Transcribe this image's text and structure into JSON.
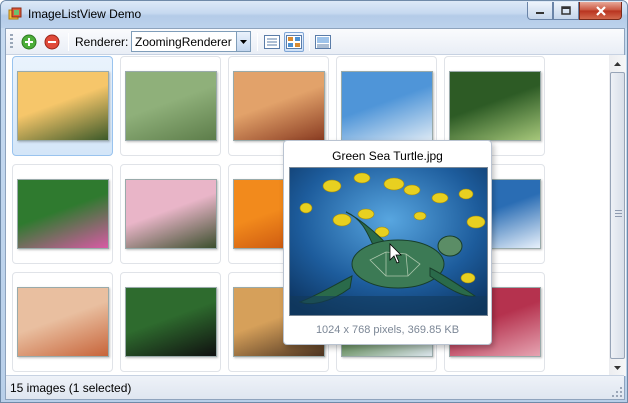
{
  "window": {
    "title": "ImageListView Demo",
    "icon": "app-icon"
  },
  "toolbar": {
    "add_icon": "add-icon",
    "remove_icon": "remove-icon",
    "renderer_label": "Renderer:",
    "renderer_value": "ZoomingRenderer",
    "view_buttons": [
      "details-view-icon",
      "thumbnails-view-icon",
      "gallery-view-icon"
    ],
    "active_view": "thumbnails-view-icon"
  },
  "thumbnails": [
    {
      "name": "sunset-tree",
      "selected": true,
      "colors": [
        "#f6c66a",
        "#3d5a2a"
      ]
    },
    {
      "name": "river-meadow",
      "selected": false,
      "colors": [
        "#8fb07a",
        "#5d7d4a"
      ]
    },
    {
      "name": "desert-monument",
      "selected": false,
      "colors": [
        "#e2a26a",
        "#8a3c22"
      ]
    },
    {
      "name": "green-sea-turtle",
      "selected": false,
      "colors": [
        "#4f95d8",
        "#dbe8f4"
      ]
    },
    {
      "name": "forest-path",
      "selected": false,
      "colors": [
        "#2d5b25",
        "#a6c77a"
      ]
    },
    {
      "name": "pink-flowers-green",
      "selected": false,
      "colors": [
        "#2f7a2f",
        "#d95aa5"
      ]
    },
    {
      "name": "pink-blossoms",
      "selected": false,
      "colors": [
        "#e9b5c8",
        "#3b4f2d"
      ]
    },
    {
      "name": "orange-flowers",
      "selected": false,
      "colors": [
        "#f28a1c",
        "#c24b0d"
      ]
    },
    {
      "name": "hidden-blue",
      "selected": false,
      "colors": [
        "#6da9dc",
        "#bcd7ef"
      ]
    },
    {
      "name": "whale-splash",
      "selected": false,
      "colors": [
        "#2a6db4",
        "#e8f1fb"
      ]
    },
    {
      "name": "desert-oryx",
      "selected": false,
      "colors": [
        "#e9bfa0",
        "#c7643a"
      ]
    },
    {
      "name": "toucan",
      "selected": false,
      "colors": [
        "#2e6b2e",
        "#101010"
      ]
    },
    {
      "name": "autumn-trees",
      "selected": false,
      "colors": [
        "#d6a05a",
        "#4c3320"
      ]
    },
    {
      "name": "waterfall",
      "selected": false,
      "colors": [
        "#4a7a3a",
        "#d9e3ea"
      ]
    },
    {
      "name": "frosted-leaves",
      "selected": false,
      "colors": [
        "#b5324e",
        "#e6a4b2"
      ]
    }
  ],
  "zoom_popup": {
    "title": "Green Sea Turtle.jpg",
    "info": "1024 x 768 pixels, 369.85 KB"
  },
  "status": {
    "text": "15 images (1 selected)"
  }
}
